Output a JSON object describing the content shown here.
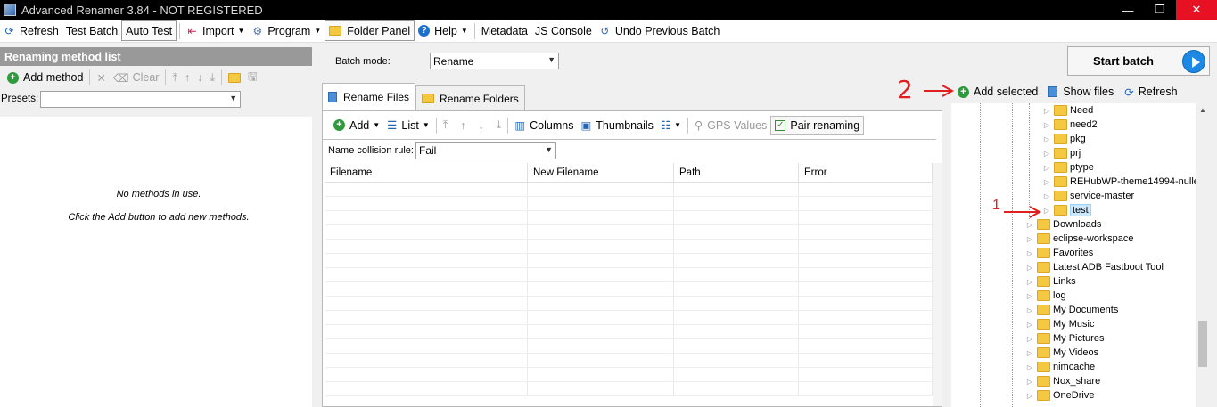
{
  "window": {
    "title": "Advanced Renamer 3.84 - NOT REGISTERED",
    "controls": [
      "—",
      "❐",
      "✕"
    ]
  },
  "menu": {
    "refresh": "Refresh",
    "test_batch": "Test Batch",
    "auto_test": "Auto Test",
    "import": "Import",
    "program": "Program",
    "folder_panel": "Folder Panel",
    "help": "Help",
    "metadata": "Metadata",
    "js_console": "JS Console",
    "undo": "Undo Previous Batch"
  },
  "left_panel": {
    "header": "Renaming method list",
    "add_method": "Add method",
    "clear": "Clear",
    "presets_label": "Presets:",
    "presets_value": "",
    "empty_msg1": "No methods in use.",
    "empty_msg2": "Click the Add button to add new methods."
  },
  "batch": {
    "label": "Batch mode:",
    "value": "Rename"
  },
  "tabs": {
    "rename_files": "Rename Files",
    "rename_folders": "Rename Folders"
  },
  "center_tools": {
    "add": "Add",
    "list": "List",
    "columns": "Columns",
    "thumbnails": "Thumbnails",
    "gps": "GPS Values",
    "pair": "Pair renaming"
  },
  "collision": {
    "label": "Name collision rule:",
    "value": "Fail"
  },
  "grid": {
    "columns": [
      "Filename",
      "New Filename",
      "Path",
      "Error"
    ]
  },
  "start_batch": "Start batch",
  "right_tools": {
    "add_selected": "Add selected",
    "show_files": "Show files",
    "refresh": "Refresh"
  },
  "tree": {
    "items": [
      "Need",
      "need2",
      "pkg",
      "prj",
      "ptype",
      "REHubWP-theme14994-nulle",
      "service-master",
      "test",
      "Downloads",
      "eclipse-workspace",
      "Favorites",
      "Latest ADB Fastboot Tool",
      "Links",
      "log",
      "My Documents",
      "My Music",
      "My Pictures",
      "My Videos",
      "nimcache",
      "Nox_share",
      "OneDrive"
    ],
    "selected": "test"
  },
  "annotations": {
    "two": "2",
    "one": "1"
  },
  "colors": {
    "accent": "#1e88e5",
    "annotation": "#e02020",
    "header": "#999999"
  }
}
